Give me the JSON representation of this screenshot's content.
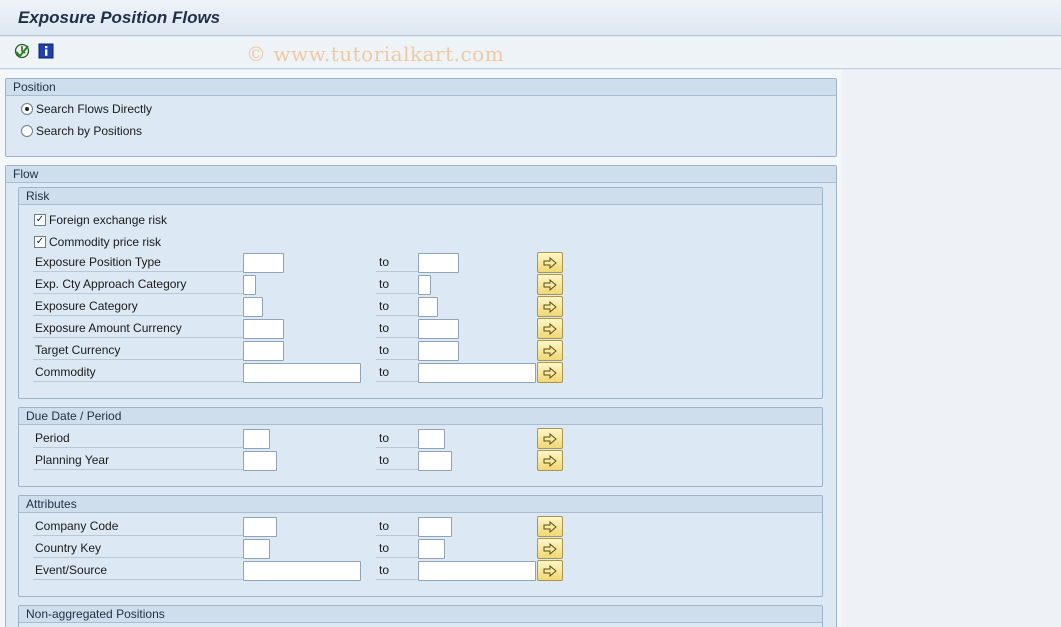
{
  "app": {
    "title": "Exposure Position Flows",
    "watermark": "© www.tutorialkart.com"
  },
  "toolbar": {
    "icons": [
      "execute-icon",
      "info-icon"
    ]
  },
  "position": {
    "header": "Position",
    "options": [
      {
        "label": "Search Flows Directly",
        "selected": true
      },
      {
        "label": "Search by Positions",
        "selected": false
      }
    ]
  },
  "flow": {
    "header": "Flow",
    "risk": {
      "header": "Risk",
      "checks": [
        {
          "label": "Foreign exchange risk",
          "checked": true
        },
        {
          "label": "Commodity price risk",
          "checked": true
        }
      ],
      "fields": [
        {
          "label": "Exposure Position Type",
          "from": "",
          "to_label": "to",
          "to": ""
        },
        {
          "label": "Exp. Cty Approach Category",
          "from": "",
          "to_label": "to",
          "to": ""
        },
        {
          "label": "Exposure Category",
          "from": "",
          "to_label": "to",
          "to": ""
        },
        {
          "label": "Exposure Amount Currency",
          "from": "",
          "to_label": "to",
          "to": ""
        },
        {
          "label": "Target Currency",
          "from": "",
          "to_label": "to",
          "to": ""
        },
        {
          "label": "Commodity",
          "from": "",
          "to_label": "to",
          "to": ""
        }
      ]
    },
    "due_date": {
      "header": "Due Date / Period",
      "fields": [
        {
          "label": "Period",
          "from": "",
          "to_label": "to",
          "to": ""
        },
        {
          "label": "Planning Year",
          "from": "",
          "to_label": "to",
          "to": ""
        }
      ]
    },
    "attributes": {
      "header": "Attributes",
      "fields": [
        {
          "label": "Company Code",
          "from": "",
          "to_label": "to",
          "to": ""
        },
        {
          "label": "Country Key",
          "from": "",
          "to_label": "to",
          "to": ""
        },
        {
          "label": "Event/Source",
          "from": "",
          "to_label": "to",
          "to": ""
        }
      ]
    },
    "non_aggregated": {
      "header": "Non-aggregated Positions"
    }
  },
  "colors": {
    "group_bg": "#dce8f3",
    "arrow_button": "#f1d874"
  }
}
